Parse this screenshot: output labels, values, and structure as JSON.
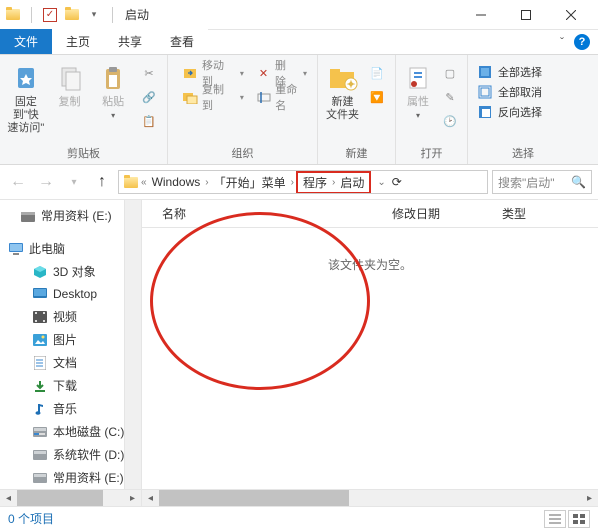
{
  "title": "启动",
  "tabs": {
    "file": "文件",
    "home": "主页",
    "share": "共享",
    "view": "查看"
  },
  "ribbon": {
    "pin": "固定到\"快\n速访问\"",
    "copy": "复制",
    "paste": "粘贴",
    "clipboard": "剪贴板",
    "moveTo": "移动到",
    "copyTo": "复制到",
    "delete": "删除",
    "rename": "重命名",
    "organize": "组织",
    "newFolder": "新建\n文件夹",
    "new": "新建",
    "properties": "属性",
    "open": "打开",
    "selectAll": "全部选择",
    "selectNone": "全部取消",
    "invertSel": "反向选择",
    "select": "选择"
  },
  "breadcrumbs": [
    "Windows",
    "「开始」菜单",
    "程序",
    "启动"
  ],
  "search_placeholder": "搜索\"启动\"",
  "columns": {
    "name": "名称",
    "date": "修改日期",
    "type": "类型"
  },
  "empty_text": "该文件夹为空。",
  "sidebar": {
    "commonData": "常用资料 (E:)",
    "thisPC": "此电脑",
    "obj3d": "3D 对象",
    "desktop": "Desktop",
    "videos": "视频",
    "pictures": "图片",
    "documents": "文档",
    "downloads": "下载",
    "music": "音乐",
    "localC": "本地磁盘 (C:)",
    "sysD": "系统软件 (D:)",
    "commonE": "常用资料 (E:)"
  },
  "status": "0 个项目"
}
